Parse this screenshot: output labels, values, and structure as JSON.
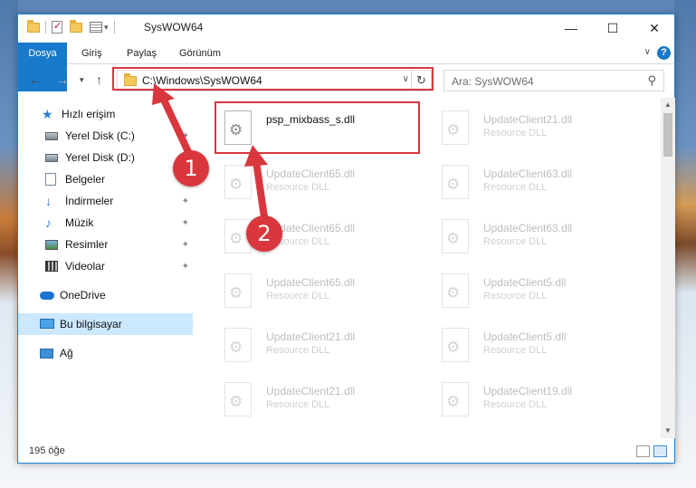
{
  "window": {
    "title": "SysWOW64",
    "minimize_label": "—",
    "maximize_label": "☐",
    "close_label": "✕"
  },
  "ribbon": {
    "tabs": [
      "Dosya",
      "Giriş",
      "Paylaş",
      "Görünüm"
    ],
    "help_label": "?"
  },
  "address": {
    "path": "C:\\Windows\\SysWOW64",
    "search_placeholder": "Ara: SysWOW64"
  },
  "sidebar": {
    "items": [
      {
        "label": "Hızlı erişim",
        "icon": "star-icon"
      },
      {
        "label": "Yerel Disk (C:)",
        "icon": "drive-icon"
      },
      {
        "label": "Yerel Disk (D:)",
        "icon": "drive-icon"
      },
      {
        "label": "Belgeler",
        "icon": "documents-icon"
      },
      {
        "label": "İndirmeler",
        "icon": "downloads-icon"
      },
      {
        "label": "Müzik",
        "icon": "music-icon"
      },
      {
        "label": "Resimler",
        "icon": "pictures-icon"
      },
      {
        "label": "Videolar",
        "icon": "videos-icon"
      },
      {
        "label": "OneDrive",
        "icon": "cloud-icon"
      },
      {
        "label": "Bu bilgisayar",
        "icon": "computer-icon"
      },
      {
        "label": "Ağ",
        "icon": "network-icon"
      }
    ]
  },
  "files": [
    {
      "name": "psp_mixbass_s.dll",
      "type": ""
    },
    {
      "name": "UpdateClient21.dll",
      "type": "Resource DLL"
    },
    {
      "name": "UpdateClient65.dll",
      "type": "Resource DLL"
    },
    {
      "name": "UpdateClient63.dll",
      "type": "Resource DLL"
    },
    {
      "name": "UpdateClient65.dll",
      "type": "Resource DLL"
    },
    {
      "name": "UpdateClient63.dll",
      "type": "Resource DLL"
    },
    {
      "name": "UpdateClient65.dll",
      "type": "Resource DLL"
    },
    {
      "name": "UpdateClient5.dll",
      "type": "Resource DLL"
    },
    {
      "name": "UpdateClient21.dll",
      "type": "Resource DLL"
    },
    {
      "name": "UpdateClient5.dll",
      "type": "Resource DLL"
    },
    {
      "name": "UpdateClient21.dll",
      "type": "Resource DLL"
    },
    {
      "name": "UpdateClient19.dll",
      "type": "Resource DLL"
    }
  ],
  "status": {
    "item_count": "195 öğe"
  },
  "annotations": {
    "step1": "1",
    "step2": "2"
  },
  "colors": {
    "accent": "#1979ca",
    "highlight": "#d9363e",
    "selected": "#cce8ff"
  }
}
